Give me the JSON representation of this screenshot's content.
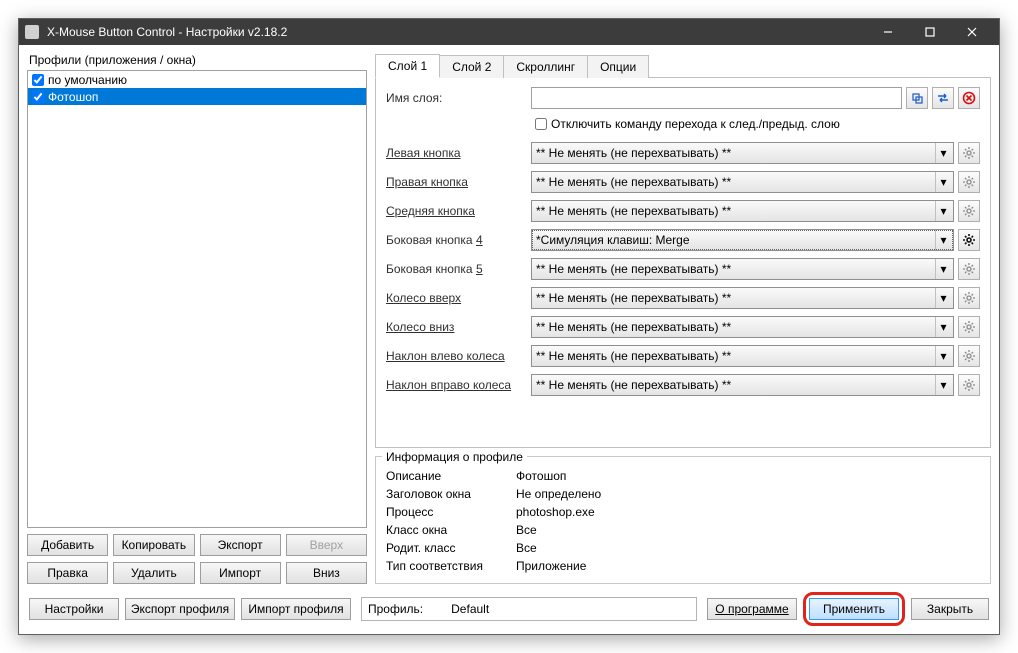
{
  "title": "X-Mouse Button Control - Настройки v2.18.2",
  "profiles_label": "Профили (приложения / окна)",
  "profiles": [
    {
      "label": "по умолчанию",
      "checked": true,
      "selected": false
    },
    {
      "label": "Фотошоп",
      "checked": true,
      "selected": true
    }
  ],
  "left_buttons_row1": {
    "add": "Добавить",
    "copy": "Копировать",
    "export": "Экспорт",
    "up": "Вверх"
  },
  "left_buttons_row2": {
    "edit": "Правка",
    "delete": "Удалить",
    "import": "Импорт",
    "down": "Вниз"
  },
  "tabs": {
    "layer1": "Слой 1",
    "layer2": "Слой 2",
    "scroll": "Скроллинг",
    "options": "Опции"
  },
  "layer": {
    "name_label": "Имя слоя:",
    "name_value": "",
    "disable_switch": "Отключить команду перехода к след./предыд. слою",
    "default_option": "** Не менять (не перехватывать) **",
    "side4_option": "*Симуляция клавиш: Merge",
    "rows": {
      "left": "Левая кнопка",
      "right": "Правая кнопка",
      "middle": "Средняя кнопка",
      "side4_a": "Боковая кнопка ",
      "side4_b": "4",
      "side5_a": "Боковая кнопка ",
      "side5_b": "5",
      "wheelup": "Колесо вверх",
      "wheeldown": "Колесо вниз",
      "tiltleft": "Наклон влево колеса",
      "tiltright": "Наклон вправо колеса"
    }
  },
  "info": {
    "legend": "Информация о профиле",
    "desc_l": "Описание",
    "desc_v": "Фотошоп",
    "title_l": "Заголовок окна",
    "title_v": "Не определено",
    "proc_l": "Процесс",
    "proc_v": "photoshop.exe",
    "class_l": "Класс окна",
    "class_v": "Все",
    "pclass_l": "Родит. класс",
    "pclass_v": "Все",
    "match_l": "Тип соответствия",
    "match_v": "Приложение"
  },
  "bottom": {
    "settings": "Настройки",
    "export_profile": "Экспорт профиля",
    "import_profile": "Импорт профиля",
    "profile_l": "Профиль:",
    "profile_v": "Default",
    "about": "О программе",
    "apply": "Применить",
    "close": "Закрыть"
  }
}
